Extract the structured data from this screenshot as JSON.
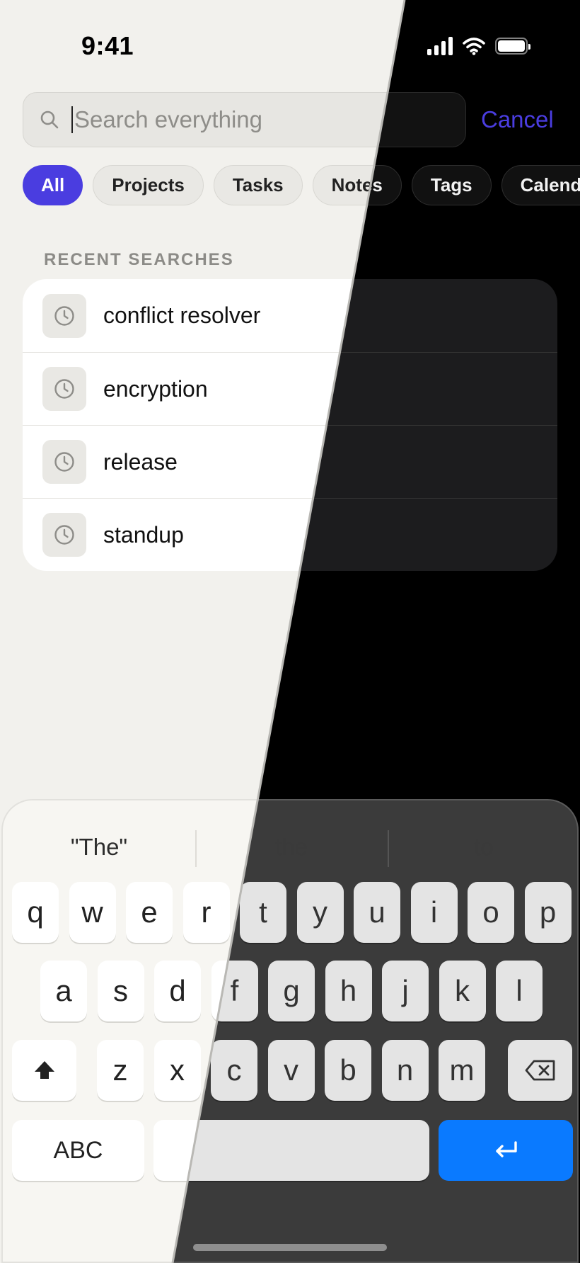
{
  "status_bar": {
    "time": "9:41"
  },
  "search": {
    "placeholder": "Search everything",
    "value": "",
    "cancel_label": "Cancel"
  },
  "filters": [
    {
      "label": "All",
      "active": true
    },
    {
      "label": "Projects",
      "active": false
    },
    {
      "label": "Tasks",
      "active": false
    },
    {
      "label": "Notes",
      "active": false
    },
    {
      "label": "Tags",
      "active": false
    },
    {
      "label": "Calendar",
      "active": false
    }
  ],
  "recent": {
    "heading": "RECENT SEARCHES",
    "items": [
      {
        "label": "conflict resolver",
        "icon": "clock-icon"
      },
      {
        "label": "encryption",
        "icon": "clock-icon"
      },
      {
        "label": "release",
        "icon": "clock-icon"
      },
      {
        "label": "standup",
        "icon": "clock-icon"
      }
    ]
  },
  "keyboard": {
    "suggestions": [
      "\"The\"",
      "the",
      "to"
    ],
    "row1": [
      "q",
      "w",
      "e",
      "r",
      "t",
      "y",
      "u",
      "i",
      "o",
      "p"
    ],
    "row2": [
      "a",
      "s",
      "d",
      "f",
      "g",
      "h",
      "j",
      "k",
      "l"
    ],
    "row3": [
      "z",
      "x",
      "c",
      "v",
      "b",
      "n",
      "m"
    ],
    "abc_label": "ABC",
    "shift_icon": "shift-icon",
    "backspace_icon": "backspace-icon",
    "return_icon": "return-icon"
  },
  "colors": {
    "accent": "#4a3de0",
    "return_key": "#0a7aff",
    "light_background": "#f2f1ed",
    "dark_background": "#000000"
  }
}
